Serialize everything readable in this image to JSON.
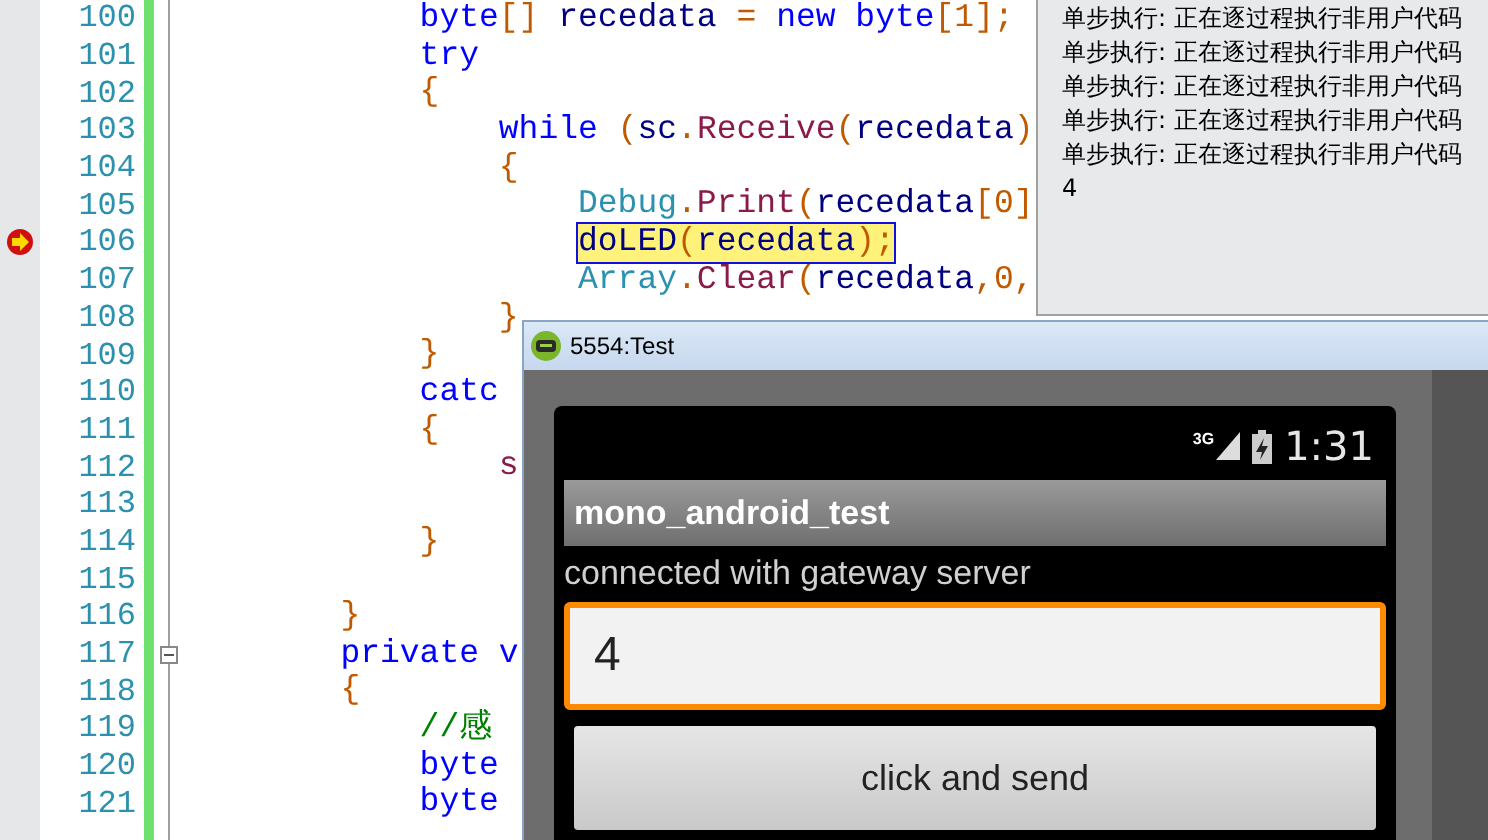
{
  "code_editor": {
    "lines": [
      {
        "number": "100",
        "current": false,
        "fold": false,
        "tokens": [
          {
            "kind": "keyword",
            "text": "byte"
          },
          {
            "kind": "punct",
            "text": "[] "
          },
          {
            "kind": "ident",
            "text": "recedata"
          },
          {
            "kind": "punct",
            "text": " = "
          },
          {
            "kind": "keyword",
            "text": "new byte"
          },
          {
            "kind": "punct",
            "text": "[1];"
          }
        ]
      },
      {
        "number": "101",
        "current": false,
        "fold": false,
        "tokens": [
          {
            "kind": "keyword",
            "text": "try"
          }
        ]
      },
      {
        "number": "102",
        "current": false,
        "fold": false,
        "tokens": [
          {
            "kind": "punct",
            "text": "{"
          }
        ]
      },
      {
        "number": "103",
        "current": false,
        "fold": false,
        "tokens": [
          {
            "kind": "keyword",
            "text": "while"
          },
          {
            "kind": "punct",
            "text": " ("
          },
          {
            "kind": "ident",
            "text": "sc"
          },
          {
            "kind": "punct",
            "text": "."
          },
          {
            "kind": "method",
            "text": "Receive"
          },
          {
            "kind": "punct",
            "text": "("
          },
          {
            "kind": "ident",
            "text": "recedata"
          },
          {
            "kind": "punct",
            "text": ")"
          }
        ]
      },
      {
        "number": "104",
        "current": false,
        "fold": false,
        "tokens": [
          {
            "kind": "punct",
            "text": "{"
          }
        ]
      },
      {
        "number": "105",
        "current": false,
        "fold": false,
        "tokens": [
          {
            "kind": "type",
            "text": "Debug"
          },
          {
            "kind": "punct",
            "text": "."
          },
          {
            "kind": "method",
            "text": "Print"
          },
          {
            "kind": "punct",
            "text": "("
          },
          {
            "kind": "ident",
            "text": "recedata"
          },
          {
            "kind": "punct",
            "text": "[0]"
          }
        ]
      },
      {
        "number": "106",
        "current": true,
        "fold": false,
        "tokens": [
          {
            "kind": "ident",
            "text": "doLED"
          },
          {
            "kind": "punct",
            "text": "("
          },
          {
            "kind": "ident",
            "text": "recedata"
          },
          {
            "kind": "punct",
            "text": ");"
          }
        ]
      },
      {
        "number": "107",
        "current": false,
        "fold": false,
        "tokens": [
          {
            "kind": "type",
            "text": "Array"
          },
          {
            "kind": "punct",
            "text": "."
          },
          {
            "kind": "method",
            "text": "Clear"
          },
          {
            "kind": "punct",
            "text": "("
          },
          {
            "kind": "ident",
            "text": "recedata"
          },
          {
            "kind": "punct",
            "text": ",0,"
          }
        ]
      },
      {
        "number": "108",
        "current": false,
        "fold": false,
        "tokens": [
          {
            "kind": "punct",
            "text": "}"
          }
        ]
      },
      {
        "number": "109",
        "current": false,
        "fold": false,
        "tokens": [
          {
            "kind": "punct",
            "text": "}"
          }
        ]
      },
      {
        "number": "110",
        "current": false,
        "fold": false,
        "tokens": [
          {
            "kind": "keyword",
            "text": "catc"
          }
        ]
      },
      {
        "number": "111",
        "current": false,
        "fold": false,
        "tokens": [
          {
            "kind": "punct",
            "text": "{"
          }
        ]
      },
      {
        "number": "112",
        "current": false,
        "fold": false,
        "tokens": [
          {
            "kind": "method",
            "text": "s"
          }
        ]
      },
      {
        "number": "113",
        "current": false,
        "fold": false
      },
      {
        "number": "114",
        "current": false,
        "fold": false,
        "tokens": [
          {
            "kind": "punct",
            "text": "}"
          }
        ]
      },
      {
        "number": "115",
        "current": false,
        "fold": false
      },
      {
        "number": "116",
        "current": false,
        "fold": false,
        "tokens": [
          {
            "kind": "punct",
            "text": "}"
          }
        ]
      },
      {
        "number": "117",
        "current": false,
        "fold": true,
        "tokens": [
          {
            "kind": "keyword",
            "text": "private v"
          }
        ]
      },
      {
        "number": "118",
        "current": false,
        "fold": false,
        "tokens": [
          {
            "kind": "punct",
            "text": "{"
          }
        ]
      },
      {
        "number": "119",
        "current": false,
        "fold": false,
        "tokens": [
          {
            "kind": "comment",
            "text": "//感"
          }
        ]
      },
      {
        "number": "120",
        "current": false,
        "fold": false,
        "tokens": [
          {
            "kind": "keyword",
            "text": "byte"
          }
        ]
      },
      {
        "number": "121",
        "current": false,
        "fold": false,
        "tokens": [
          {
            "kind": "keyword",
            "text": "byte"
          }
        ]
      }
    ]
  },
  "output_pane": {
    "lines": [
      "单步执行: 正在逐过程执行非用户代码",
      "单步执行: 正在逐过程执行非用户代码",
      "单步执行: 正在逐过程执行非用户代码",
      "单步执行: 正在逐过程执行非用户代码",
      "单步执行: 正在逐过程执行非用户代码",
      "4"
    ]
  },
  "emulator": {
    "title": "5554:Test",
    "clock": "1:31",
    "network": "3G",
    "app_title": "mono_android_test",
    "status_text": "connected with gateway server",
    "input": {
      "value": "4",
      "focused": true
    },
    "button": "click and send"
  }
}
